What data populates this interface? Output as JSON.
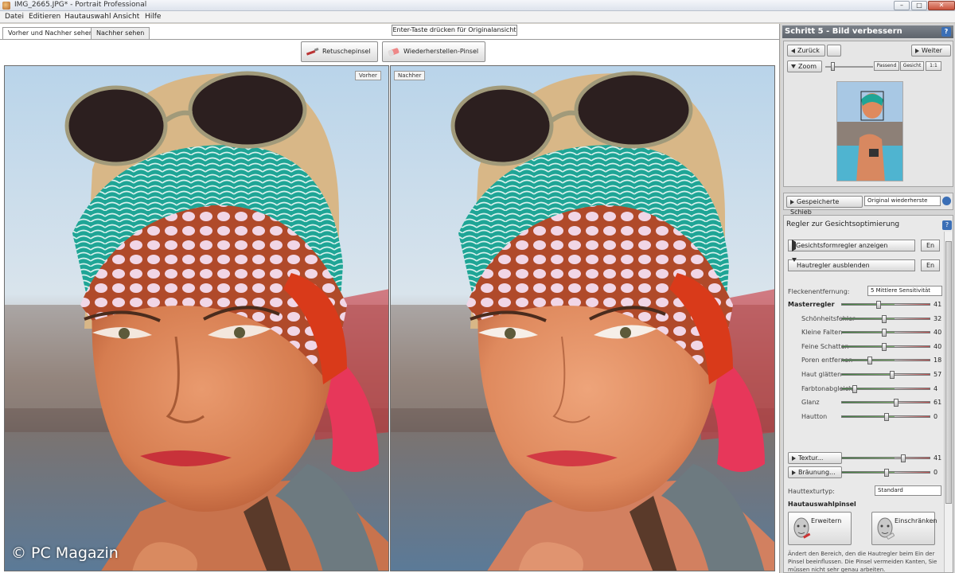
{
  "window": {
    "title": "IMG_2665.JPG* - Portrait Professional",
    "minimize": "–",
    "maximize": "□",
    "close": "✕"
  },
  "menu": [
    "Datei",
    "Editieren",
    "Hautauswahl",
    "Ansicht",
    "Hilfe"
  ],
  "tabs": [
    {
      "label": "Vorher und Nachher sehen",
      "active": true
    },
    {
      "label": "Nachher sehen",
      "active": false
    }
  ],
  "hint": "Enter-Taste drücken für Originalansicht",
  "toolbar": {
    "retouch_brush": "Retuschepinsel",
    "restore_brush": "Wiederherstellen-Pinsel"
  },
  "panes": {
    "before_label": "Vorher",
    "after_label": "Nachher"
  },
  "watermark": "© PC Magazin",
  "panel": {
    "step_title": "Schritt 5 - Bild verbessern",
    "help": "?",
    "back": "Zurück",
    "next": "Weiter",
    "zoom": "Zoom",
    "zoom_fit": "Passend",
    "zoom_face": "Gesicht",
    "zoom_1to1": "1:1",
    "saved_label": "Gespeicherte Schieb",
    "saved_value": "Original wiederherste",
    "regler_title": "Regler zur Gesichtsoptimierung",
    "face_shape_toggle": "Gesichtsformregler anzeigen",
    "skin_toggle": "Hautregler ausblenden",
    "en": "En",
    "spot_label": "Fleckenentfernung:",
    "spot_value": "5 Mittlere Sensitivität",
    "texture_toggle": "Textur...",
    "tan_toggle": "Bräunung...",
    "skin_texture_label": "Hauttexturtyp:",
    "skin_texture_value": "Standard",
    "skin_brush_title": "Hautauswahlpinsel",
    "expand": "Erweitern",
    "restrict": "Einschränken",
    "description": "Ändert den Bereich, den die Hautregler beim Ein der Pinsel beeinflussen. Die Pinsel vermeiden Kanten, Sie müssen nicht sehr genau arbeiten."
  },
  "sliders": [
    {
      "label": "Masterregler",
      "value": "41",
      "pct": 0.41,
      "strong": true
    },
    {
      "label": "Schönheitsfehler",
      "value": "32",
      "pct": 0.47,
      "strong": false
    },
    {
      "label": "Kleine Falten",
      "value": "40",
      "pct": 0.47,
      "strong": false
    },
    {
      "label": "Feine Schatten",
      "value": "40",
      "pct": 0.47,
      "strong": false
    },
    {
      "label": "Poren entfernen",
      "value": "18",
      "pct": 0.3,
      "strong": false
    },
    {
      "label": "Haut glätten",
      "value": "57",
      "pct": 0.57,
      "strong": false
    },
    {
      "label": "Farbtonabgleich",
      "value": "4",
      "pct": 0.12,
      "strong": false
    },
    {
      "label": "Glanz",
      "value": "61",
      "pct": 0.61,
      "strong": false
    },
    {
      "label": "Hautton",
      "value": "0",
      "pct": 0.5,
      "strong": false
    }
  ],
  "texture_slider": {
    "value": "41",
    "pct": 0.7
  },
  "tan_slider": {
    "value": "0",
    "pct": 0.5
  }
}
